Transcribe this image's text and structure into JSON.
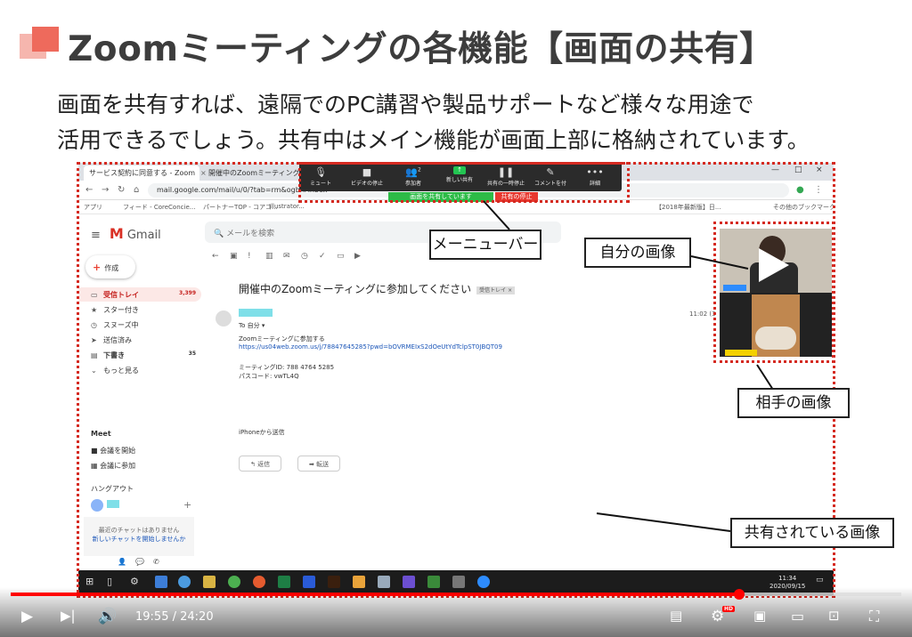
{
  "slide": {
    "title": "Zoomミーティングの各機能【画面の共有】",
    "subtitle_line1": "画面を共有すれば、遠隔でのPC講習や製品サポートなど様々な用途で",
    "subtitle_line2": "活用できるでしょう。共有中はメイン機能が画面上部に格納されています。"
  },
  "callouts": {
    "menubar": "メーニューバー",
    "self_video": "自分の画像",
    "other_video": "相手の画像",
    "shared_screen": "共有されている画像"
  },
  "browser": {
    "tab1": "サービス契約に同意する - Zoom",
    "tab2": "開催中のZoomミーティングに参",
    "url": "mail.google.com/mail/u/0/?tab=rm&ogbl#inbox",
    "bookmarks": [
      "アプリ",
      "フィード - CoreConcie...",
      "パートナーTOP - コアコ...",
      "Illustrator...",
      "【2018年最新版】日...",
      "その他のブックマーク"
    ]
  },
  "zoom_toolbar": {
    "items": [
      "ミュート",
      "ビデオの停止",
      "参加者",
      "新しい共有",
      "共有の一時停止",
      "コメントを付",
      "詳細"
    ],
    "participants_count": "2",
    "sharing_label": "画面を共有しています",
    "stop_label": "共有の停止"
  },
  "gmail": {
    "logo": "Gmail",
    "search_placeholder": "メールを検索",
    "compose": "作成",
    "nav": [
      {
        "label": "受信トレイ",
        "count": "3,399"
      },
      {
        "label": "スター付き",
        "count": ""
      },
      {
        "label": "スヌーズ中",
        "count": ""
      },
      {
        "label": "送信済み",
        "count": ""
      },
      {
        "label": "下書き",
        "count": "35"
      },
      {
        "label": "もっと見る",
        "count": ""
      }
    ],
    "meet_heading": "Meet",
    "meet_items": [
      "会議を開始",
      "会議に参加"
    ],
    "hangouts_heading": "ハングアウト",
    "chat_empty": "最近のチャットはありません",
    "chat_new": "新しいチャットを開始しませんか",
    "subject": "開催中のZoomミーティングに参加してください",
    "subject_label": "受信トレイ ×",
    "to_me": "To 自分 ▾",
    "body1": "Zoomミーティングに参加する",
    "link": "https://us04web.zoom.us/j/78847645285?pwd=bOVRMEIxS2dOeUtYdTclpST0JBQT09",
    "meeting_id": "ミーティングID: 788 4764 5285",
    "passcode": "パスコード: vwTL4Q",
    "sent_from": "iPhoneから送信",
    "reply": "返信",
    "forward": "転送",
    "time": "11:02 (3"
  },
  "taskbar": {
    "time": "11:34",
    "date": "2020/09/15"
  },
  "player": {
    "current": "19:55",
    "duration": "24:20",
    "progress": 0.818
  }
}
